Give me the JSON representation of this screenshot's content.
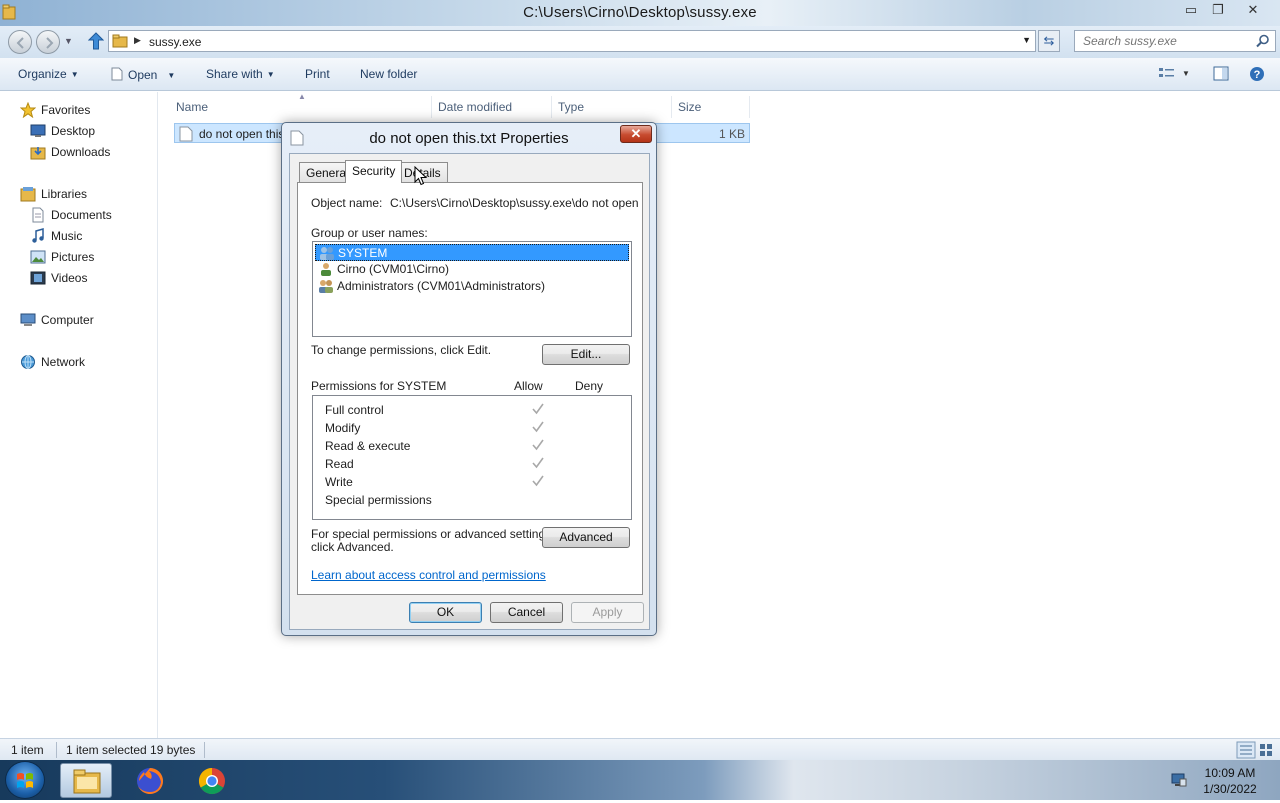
{
  "window": {
    "title": "C:\\Users\\Cirno\\Desktop\\sussy.exe",
    "min_glyph": "▭",
    "max_glyph": "❐",
    "close_glyph": "✕"
  },
  "address": {
    "breadcrumb": "sussy.exe",
    "search_placeholder": "Search sussy.exe"
  },
  "toolbar": {
    "organize": "Organize",
    "open": "Open",
    "share_with": "Share with",
    "print": "Print",
    "new_folder": "New folder"
  },
  "nav": {
    "favorites": "Favorites",
    "desktop": "Desktop",
    "downloads": "Downloads",
    "libraries": "Libraries",
    "documents": "Documents",
    "music": "Music",
    "pictures": "Pictures",
    "videos": "Videos",
    "computer": "Computer",
    "network": "Network"
  },
  "filelist": {
    "columns": [
      "Name",
      "Date modified",
      "Type",
      "Size"
    ],
    "rows": [
      {
        "name": "do not open this",
        "size": "1 KB"
      }
    ]
  },
  "status": {
    "count": "1 item",
    "selected": "1 item selected  19 bytes"
  },
  "taskbar": {
    "time": "10:09 AM",
    "date": "1/30/2022"
  },
  "dialog": {
    "title": "do not open this.txt Properties",
    "close_glyph": "✕",
    "tabs": [
      "General",
      "Security",
      "Details"
    ],
    "object_name_label": "Object name:",
    "object_name_value": "C:\\Users\\Cirno\\Desktop\\sussy.exe\\do not open th",
    "group_label": "Group or user names:",
    "users": [
      "SYSTEM",
      "Cirno (CVM01\\Cirno)",
      "Administrators (CVM01\\Administrators)"
    ],
    "change_text": "To change permissions, click Edit.",
    "edit_button": "Edit...",
    "permissions_for": "Permissions for SYSTEM",
    "allow_header": "Allow",
    "deny_header": "Deny",
    "permissions": [
      {
        "name": "Full control",
        "allow": true
      },
      {
        "name": "Modify",
        "allow": true
      },
      {
        "name": "Read & execute",
        "allow": true
      },
      {
        "name": "Read",
        "allow": true
      },
      {
        "name": "Write",
        "allow": true
      },
      {
        "name": "Special permissions",
        "allow": false
      }
    ],
    "special_text_1": "For special permissions or advanced settings,",
    "special_text_2": "click Advanced.",
    "advanced_button": "Advanced",
    "learn_link": "Learn about access control and permissions",
    "ok": "OK",
    "cancel": "Cancel",
    "apply": "Apply"
  }
}
